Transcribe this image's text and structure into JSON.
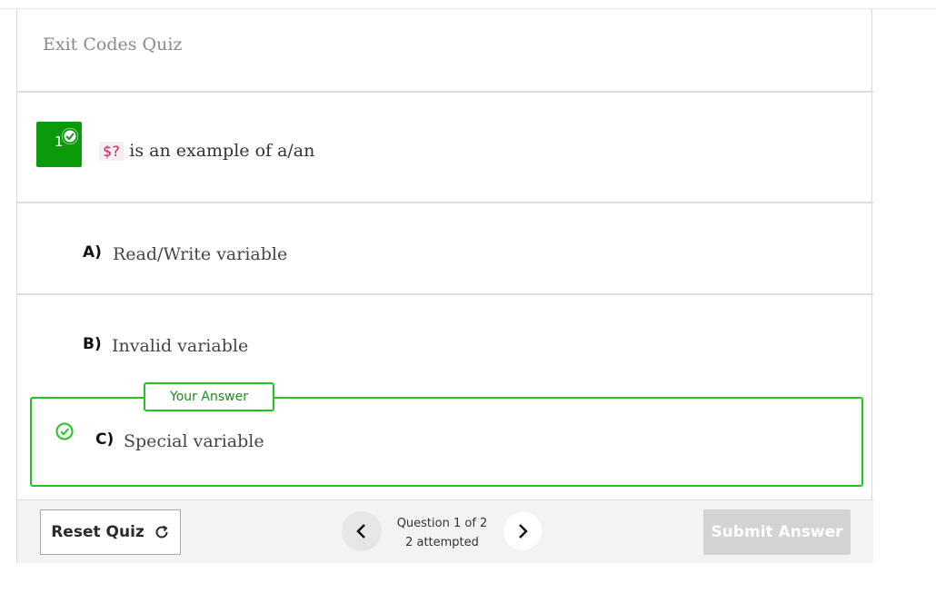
{
  "quiz": {
    "title": "Exit Codes Quiz"
  },
  "question": {
    "number": "1",
    "code": "$?",
    "text": "is an example of a/an"
  },
  "options": [
    {
      "letter": "A)",
      "text": "Read/Write variable"
    },
    {
      "letter": "B)",
      "text": "Invalid variable"
    },
    {
      "letter": "C)",
      "text": "Special variable"
    }
  ],
  "answer_tag": "Your Answer",
  "footer": {
    "reset_label": "Reset Quiz",
    "question_position": "Question 1 of 2",
    "attempted": "2 attempted",
    "submit_label": "Submit Answer"
  },
  "colors": {
    "correct": "#22c322",
    "badge": "#0a9a0a",
    "code": "#d0195a"
  },
  "icons": [
    "check-circle-icon",
    "refresh-icon",
    "chevron-left-icon",
    "chevron-right-icon"
  ]
}
